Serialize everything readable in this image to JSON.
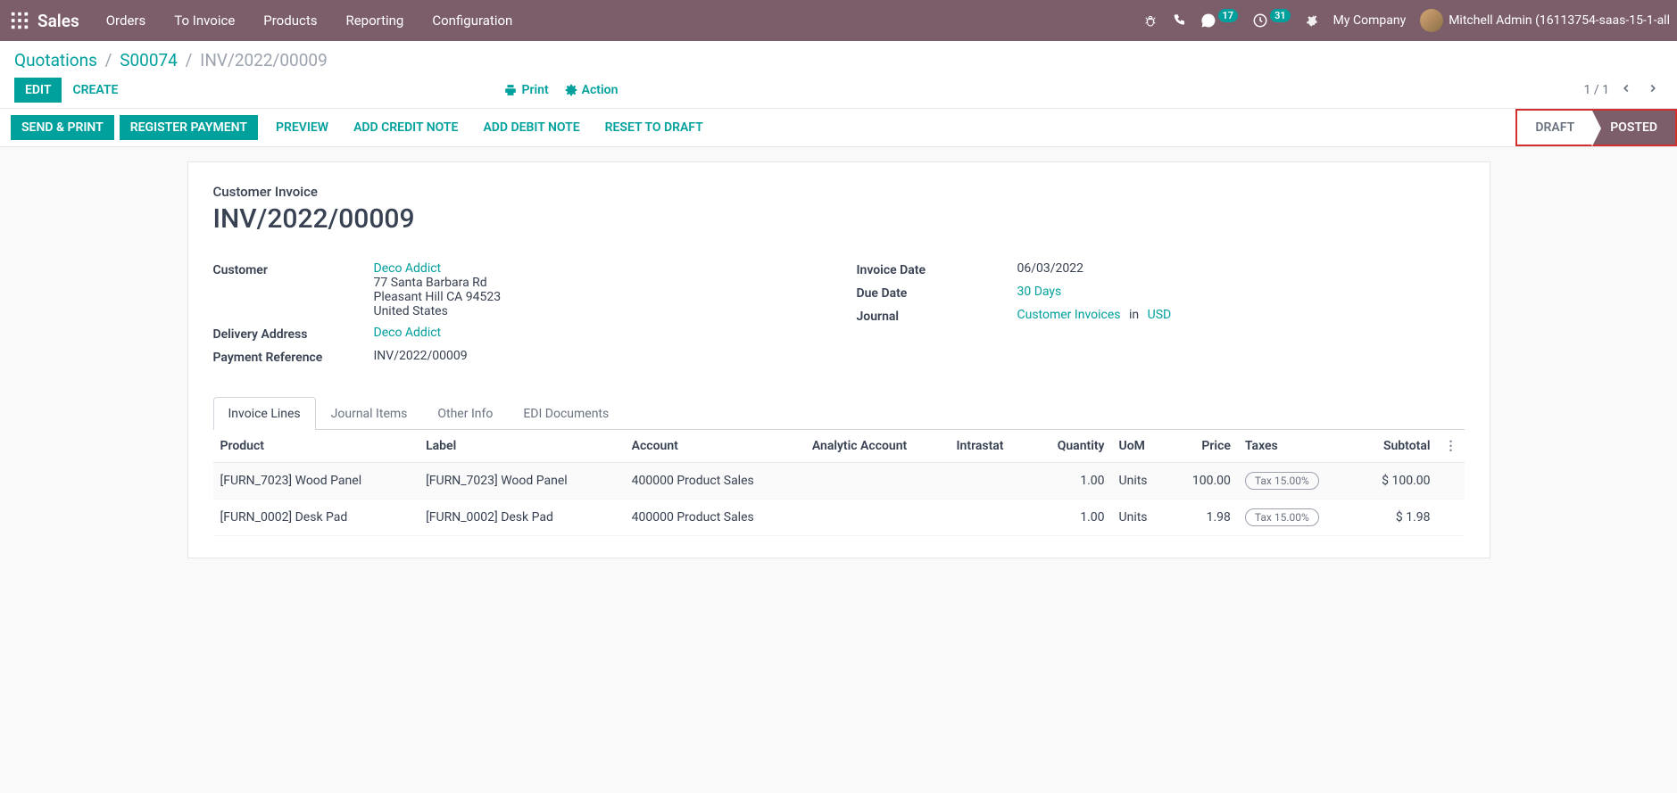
{
  "nav": {
    "app": "Sales",
    "menus": [
      "Orders",
      "To Invoice",
      "Products",
      "Reporting",
      "Configuration"
    ],
    "msg_badge": "17",
    "activity_badge": "31",
    "company": "My Company",
    "user": "Mitchell Admin (16113754-saas-15-1-all"
  },
  "breadcrumb": {
    "seg1": "Quotations",
    "seg2": "S00074",
    "current": "INV/2022/00009"
  },
  "buttons": {
    "edit": "EDIT",
    "create": "CREATE",
    "print": "Print",
    "action": "Action",
    "send_print": "SEND & PRINT",
    "register_payment": "REGISTER PAYMENT",
    "preview": "PREVIEW",
    "add_credit": "ADD CREDIT NOTE",
    "add_debit": "ADD DEBIT NOTE",
    "reset_draft": "RESET TO DRAFT"
  },
  "pager": {
    "range": "1 / 1"
  },
  "states": {
    "draft": "DRAFT",
    "posted": "POSTED"
  },
  "doc": {
    "type": "Customer Invoice",
    "name": "INV/2022/00009",
    "labels": {
      "customer": "Customer",
      "delivery_address": "Delivery Address",
      "payment_ref": "Payment Reference",
      "invoice_date": "Invoice Date",
      "due_date": "Due Date",
      "journal": "Journal"
    },
    "customer": {
      "name": "Deco Addict",
      "line1": "77 Santa Barbara Rd",
      "line2": "Pleasant Hill CA 94523",
      "line3": "United States"
    },
    "delivery_address": "Deco Addict",
    "payment_ref": "INV/2022/00009",
    "invoice_date": "06/03/2022",
    "due_date": "30 Days",
    "journal": "Customer Invoices",
    "journal_in": "in",
    "currency": "USD"
  },
  "tabs": [
    "Invoice Lines",
    "Journal Items",
    "Other Info",
    "EDI Documents"
  ],
  "table": {
    "headers": {
      "product": "Product",
      "label": "Label",
      "account": "Account",
      "analytic": "Analytic Account",
      "intrastat": "Intrastat",
      "quantity": "Quantity",
      "uom": "UoM",
      "price": "Price",
      "taxes": "Taxes",
      "subtotal": "Subtotal"
    },
    "rows": [
      {
        "product": "[FURN_7023] Wood Panel",
        "label": "[FURN_7023] Wood Panel",
        "account": "400000 Product Sales",
        "analytic": "",
        "intrastat": "",
        "qty": "1.00",
        "uom": "Units",
        "price": "100.00",
        "tax": "Tax 15.00%",
        "subtotal": "$ 100.00"
      },
      {
        "product": "[FURN_0002] Desk Pad",
        "label": "[FURN_0002] Desk Pad",
        "account": "400000 Product Sales",
        "analytic": "",
        "intrastat": "",
        "qty": "1.00",
        "uom": "Units",
        "price": "1.98",
        "tax": "Tax 15.00%",
        "subtotal": "$ 1.98"
      }
    ]
  }
}
